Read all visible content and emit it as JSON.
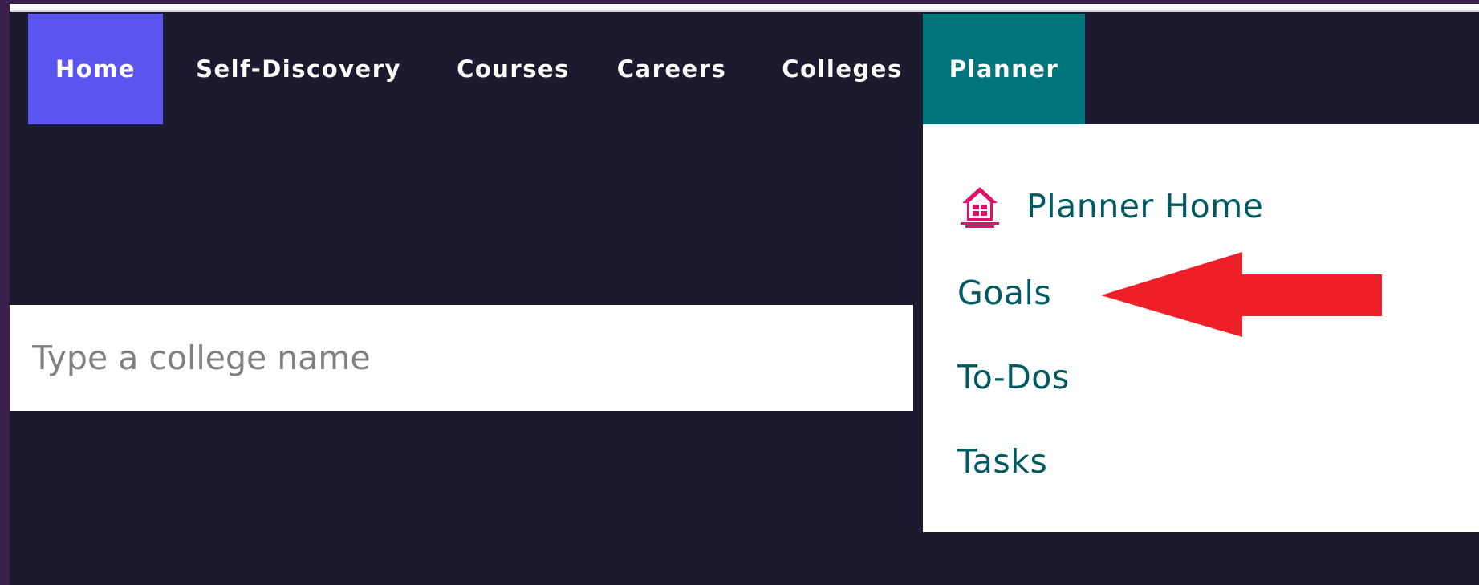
{
  "nav": {
    "items": [
      {
        "label": "Home"
      },
      {
        "label": "Self-Discovery"
      },
      {
        "label": "Courses"
      },
      {
        "label": "Careers"
      },
      {
        "label": "Colleges"
      },
      {
        "label": "Planner"
      }
    ],
    "active_item": "Home",
    "open_item": "Planner"
  },
  "planner_menu": {
    "items": [
      {
        "label": "Planner Home",
        "icon": "house-icon"
      },
      {
        "label": "Goals"
      },
      {
        "label": "To-Dos"
      },
      {
        "label": "Tasks"
      }
    ]
  },
  "search": {
    "placeholder": "Type a college name",
    "value": ""
  },
  "annotation": {
    "type": "red-arrow",
    "points_to": "Goals"
  },
  "colors": {
    "background": "#1b1a2e",
    "home_tab": "#5b55f0",
    "planner_tab": "#00757c",
    "menu_text": "#005a61",
    "house_icon": "#e0106e",
    "arrow": "#ee1f26"
  }
}
